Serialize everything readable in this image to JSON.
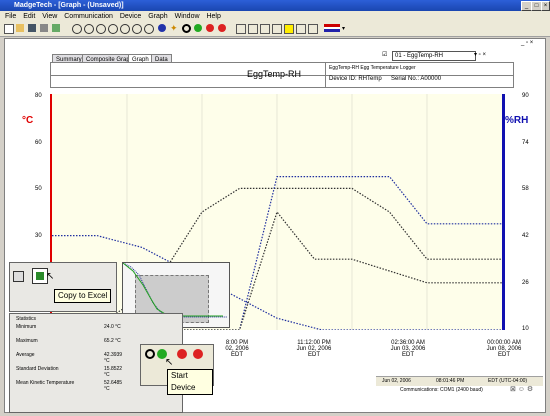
{
  "app": {
    "title": "MadgeTech - [Graph - (Unsaved)]"
  },
  "menu": [
    "File",
    "Edit",
    "View",
    "Communication",
    "Device",
    "Graph",
    "Window",
    "Help"
  ],
  "toolbar": {
    "flag_label": "UK flag"
  },
  "device_selector": {
    "value": "01 - EggTemp-RH"
  },
  "tabs": [
    "Summary",
    "Composite Graph",
    "Graph",
    "Data"
  ],
  "graph_header": {
    "title": "EggTemp-RH",
    "logger": "EggTemp-RH Egg Temperature Logger",
    "device_id": "Device ID: RHTemp",
    "serial": "Serial No.: A00000"
  },
  "axes": {
    "left_unit": "°C",
    "right_unit": "%RH",
    "left_ticks": [
      "80",
      "60",
      "50",
      "30"
    ],
    "right_ticks": [
      "90",
      "74",
      "58",
      "42",
      "26",
      "10"
    ],
    "x_ticks": [
      {
        "time": "8:00 PM",
        "date": "02, 2006",
        "tz": "EDT"
      },
      {
        "time": "11:12:00 PM",
        "date": "Jun 02, 2006",
        "tz": "EDT"
      },
      {
        "time": "02:36:00 AM",
        "date": "Jun 03, 2006",
        "tz": "EDT"
      },
      {
        "time": "00:00:00 AM",
        "date": "Jun 08, 2006",
        "tz": "EDT"
      }
    ]
  },
  "colors": {
    "temp_axis": "#e00000",
    "rh_axis": "#1010b0",
    "plot_bg": "#fefeea"
  },
  "chart_data": {
    "type": "line",
    "series": [
      {
        "values": [
          42,
          42,
          38,
          30,
          22,
          14,
          10,
          10,
          10,
          10,
          10
        ]
      },
      {
        "values": [
          10,
          10,
          18,
          30,
          50,
          58,
          58,
          58,
          58,
          50,
          34,
          34,
          34
        ]
      },
      {
        "values": [
          10,
          10,
          10,
          10,
          10,
          10,
          62,
          62,
          62,
          62,
          46,
          46,
          46
        ]
      },
      {
        "values": [
          10,
          10,
          10,
          10,
          10,
          10,
          50,
          34,
          34,
          30,
          26,
          26,
          26
        ]
      }
    ]
  },
  "small_toolbar": {
    "tooltip": "Copy to Excel"
  },
  "device_toolbar": {
    "tooltip": "Start Device"
  },
  "statistics": {
    "title": "Statistics",
    "rows": [
      {
        "label": "Minimum",
        "value": "24.0 °C"
      },
      {
        "label": "Maximum",
        "value": "65.2 °C"
      },
      {
        "label": "Average",
        "value": "42.3939 °C"
      },
      {
        "label": "Standard Deviation",
        "value": "15.8522 °C"
      },
      {
        "label": "Mean Kinetic Temperature",
        "value": "52.6485 °C"
      }
    ]
  },
  "status_bar": {
    "date": "Jun 02, 2006",
    "time": "08:01:46 PM",
    "timezone": "EDT (UTC-04:00)",
    "comms": "Communications: COM1 (2400 baud)"
  }
}
